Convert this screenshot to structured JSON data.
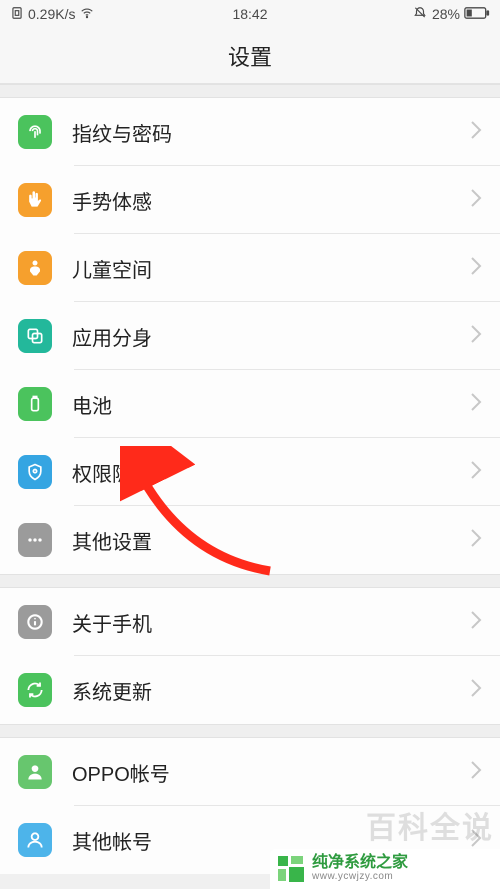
{
  "status": {
    "speed": "0.29K/s",
    "time": "18:42",
    "battery_pct": "28%"
  },
  "header": {
    "title": "设置"
  },
  "rows": {
    "fingerprint": {
      "label": "指纹与密码"
    },
    "gesture": {
      "label": "手势体感"
    },
    "kids": {
      "label": "儿童空间"
    },
    "clone": {
      "label": "应用分身"
    },
    "battery": {
      "label": "电池"
    },
    "privacy": {
      "label": "权限隐私"
    },
    "other": {
      "label": "其他设置"
    },
    "about": {
      "label": "关于手机"
    },
    "update": {
      "label": "系统更新"
    },
    "oppo": {
      "label": "OPPO帐号"
    },
    "accounts": {
      "label": "其他帐号"
    }
  },
  "watermark": {
    "top": "百科全说",
    "brand": "纯净系统之家",
    "url": "www.ycwjzy.com"
  },
  "colors": {
    "green": "#4bc35d",
    "orange": "#f6a02d",
    "teal": "#23b89b",
    "blue": "#35a5e2",
    "gray": "#9b9b9b",
    "lgreen": "#67c66e",
    "lblue": "#4db4ea"
  }
}
